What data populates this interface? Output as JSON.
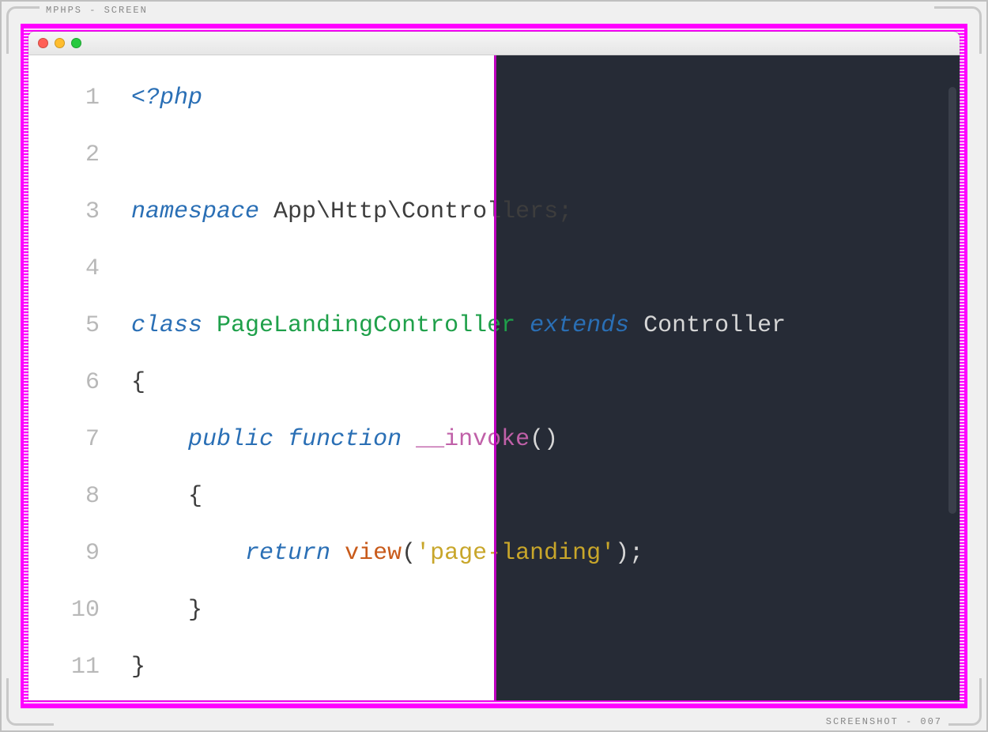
{
  "frame": {
    "label_tl": "MPHPS - SCREEN",
    "label_br": "SCREENSHOT - 007"
  },
  "editor": {
    "traffic": {
      "close": "close",
      "min": "minimize",
      "max": "maximize"
    },
    "lines": [
      {
        "num": "1",
        "tokens": [
          {
            "cls": "phpopen",
            "t": "<?php"
          }
        ]
      },
      {
        "num": "2",
        "tokens": []
      },
      {
        "num": "3",
        "tokens": [
          {
            "cls": "kw-it",
            "t": "namespace"
          },
          {
            "cls": "plain",
            "t": " App\\Http\\Controllers;"
          }
        ]
      },
      {
        "num": "4",
        "tokens": []
      },
      {
        "num": "5",
        "tokens": [
          {
            "cls": "kw-it",
            "t": "class"
          },
          {
            "cls": "plain",
            "t": " "
          },
          {
            "cls": "classname",
            "t": "PageLandingController"
          },
          {
            "cls": "plain",
            "t": " "
          },
          {
            "cls": "kw-it",
            "t": "extends"
          },
          {
            "cls": "plain",
            "t": " "
          },
          {
            "cls": "plain-dark",
            "t": "Controller"
          }
        ]
      },
      {
        "num": "6",
        "tokens": [
          {
            "cls": "brace",
            "t": "{"
          }
        ]
      },
      {
        "num": "7",
        "tokens": [
          {
            "cls": "plain",
            "t": "    "
          },
          {
            "cls": "kw-it",
            "t": "public"
          },
          {
            "cls": "plain",
            "t": " "
          },
          {
            "cls": "kw-it",
            "t": "function"
          },
          {
            "cls": "plain",
            "t": " "
          },
          {
            "cls": "method",
            "t": "__invoke"
          },
          {
            "cls": "plain-dark",
            "t": "()"
          }
        ]
      },
      {
        "num": "8",
        "tokens": [
          {
            "cls": "plain",
            "t": "    "
          },
          {
            "cls": "brace",
            "t": "{"
          }
        ]
      },
      {
        "num": "9",
        "tokens": [
          {
            "cls": "plain",
            "t": "        "
          },
          {
            "cls": "kw-it",
            "t": "return"
          },
          {
            "cls": "plain",
            "t": " "
          },
          {
            "cls": "builtin",
            "t": "view"
          },
          {
            "cls": "plain",
            "t": "("
          },
          {
            "cls": "string",
            "t": "'page-landing'"
          },
          {
            "cls": "plain-dark",
            "t": ");"
          }
        ]
      },
      {
        "num": "10",
        "tokens": [
          {
            "cls": "plain",
            "t": "    "
          },
          {
            "cls": "brace",
            "t": "}"
          }
        ]
      },
      {
        "num": "11",
        "tokens": [
          {
            "cls": "brace",
            "t": "}"
          }
        ]
      }
    ]
  }
}
